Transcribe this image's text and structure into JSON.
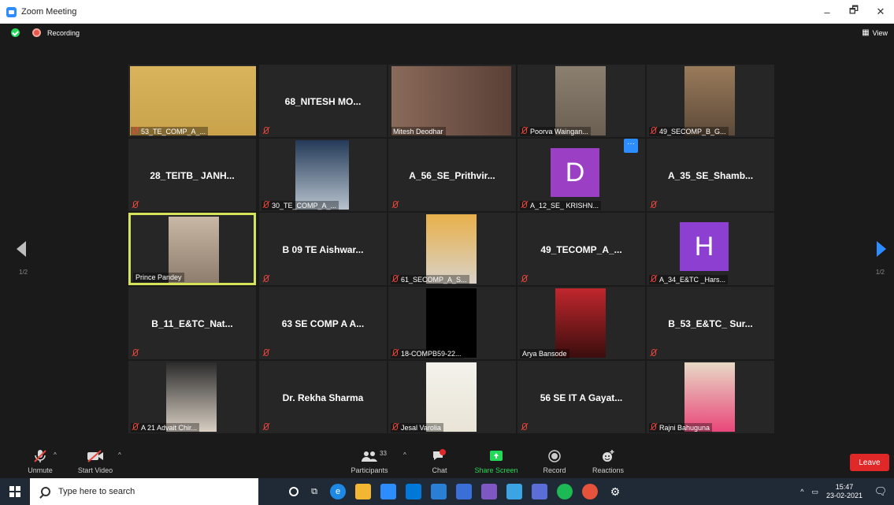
{
  "window": {
    "title": "Zoom Meeting",
    "minimize": "–",
    "restore": "🗗",
    "close": "✕"
  },
  "recording": {
    "label": "Recording"
  },
  "view": {
    "label": "View",
    "icon": "grid-icon"
  },
  "pagination": {
    "left": "1/2",
    "right": "1/2"
  },
  "tiles": [
    {
      "kind": "video",
      "label": "53_TE_COMP_A_...",
      "muted": true
    },
    {
      "kind": "name",
      "name": "68_NITESH  MO...",
      "muted": true
    },
    {
      "kind": "video",
      "label": "Mitesh Deodhar",
      "muted": false
    },
    {
      "kind": "video",
      "label": "Poorva Waingan...",
      "muted": true
    },
    {
      "kind": "video",
      "label": "49_SECOMP_B_G...",
      "muted": true
    },
    {
      "kind": "name",
      "name": "28_TEITB_ JANH...",
      "muted": true
    },
    {
      "kind": "video",
      "label": "30_TE_COMP_A_...",
      "muted": true
    },
    {
      "kind": "name",
      "name": "A_56_SE_Prithvir...",
      "muted": true
    },
    {
      "kind": "avatar",
      "letter": "D",
      "label": "A_12_SE_ KRISHN...",
      "muted": true,
      "color": "#9b3fc4"
    },
    {
      "kind": "name",
      "name": "A_35_SE_Shamb...",
      "muted": true
    },
    {
      "kind": "video",
      "label": "Prince Pandey",
      "muted": false,
      "active": true
    },
    {
      "kind": "name",
      "name": "B 09 TE Aishwar...",
      "muted": true
    },
    {
      "kind": "video",
      "label": "61_SECOMP_A_S...",
      "muted": true
    },
    {
      "kind": "name",
      "name": "49_TECOMP_A_...",
      "muted": true
    },
    {
      "kind": "avatar",
      "letter": "H",
      "label": "A_34_E&TC _Hars...",
      "muted": true,
      "color": "#8c3fd1"
    },
    {
      "kind": "name",
      "name": "B_11_E&TC_Nat...",
      "muted": true
    },
    {
      "kind": "name",
      "name": "63 SE COMP A A...",
      "muted": true
    },
    {
      "kind": "video",
      "label": "18-COMPB59-22...",
      "muted": true
    },
    {
      "kind": "video",
      "label": "Arya Bansode",
      "muted": false
    },
    {
      "kind": "name",
      "name": "B_53_E&TC_ Sur...",
      "muted": true
    },
    {
      "kind": "video",
      "label": "A 21 Advait Chir...",
      "muted": true
    },
    {
      "kind": "name",
      "name": "Dr. Rekha Sharma",
      "muted": true
    },
    {
      "kind": "video",
      "label": "Jesal Varolia",
      "muted": true
    },
    {
      "kind": "name",
      "name": "56 SE IT A Gayat...",
      "muted": true
    },
    {
      "kind": "video",
      "label": "Rajni Bahuguna",
      "muted": true
    }
  ],
  "tile_more": "···",
  "toolbar": {
    "unmute": "Unmute",
    "start_video": "Start Video",
    "participants": "Participants",
    "participants_count": "33",
    "chat": "Chat",
    "share_screen": "Share Screen",
    "record": "Record",
    "reactions": "Reactions",
    "leave": "Leave"
  },
  "taskbar": {
    "search_placeholder": "Type here to search",
    "time": "15:47",
    "date": "23-02-2021",
    "tray_caret": "^"
  },
  "colors": {
    "accent": "#2d8cff",
    "leave": "#e02828",
    "active_border": "#d7e25b",
    "share_green": "#23d959"
  }
}
